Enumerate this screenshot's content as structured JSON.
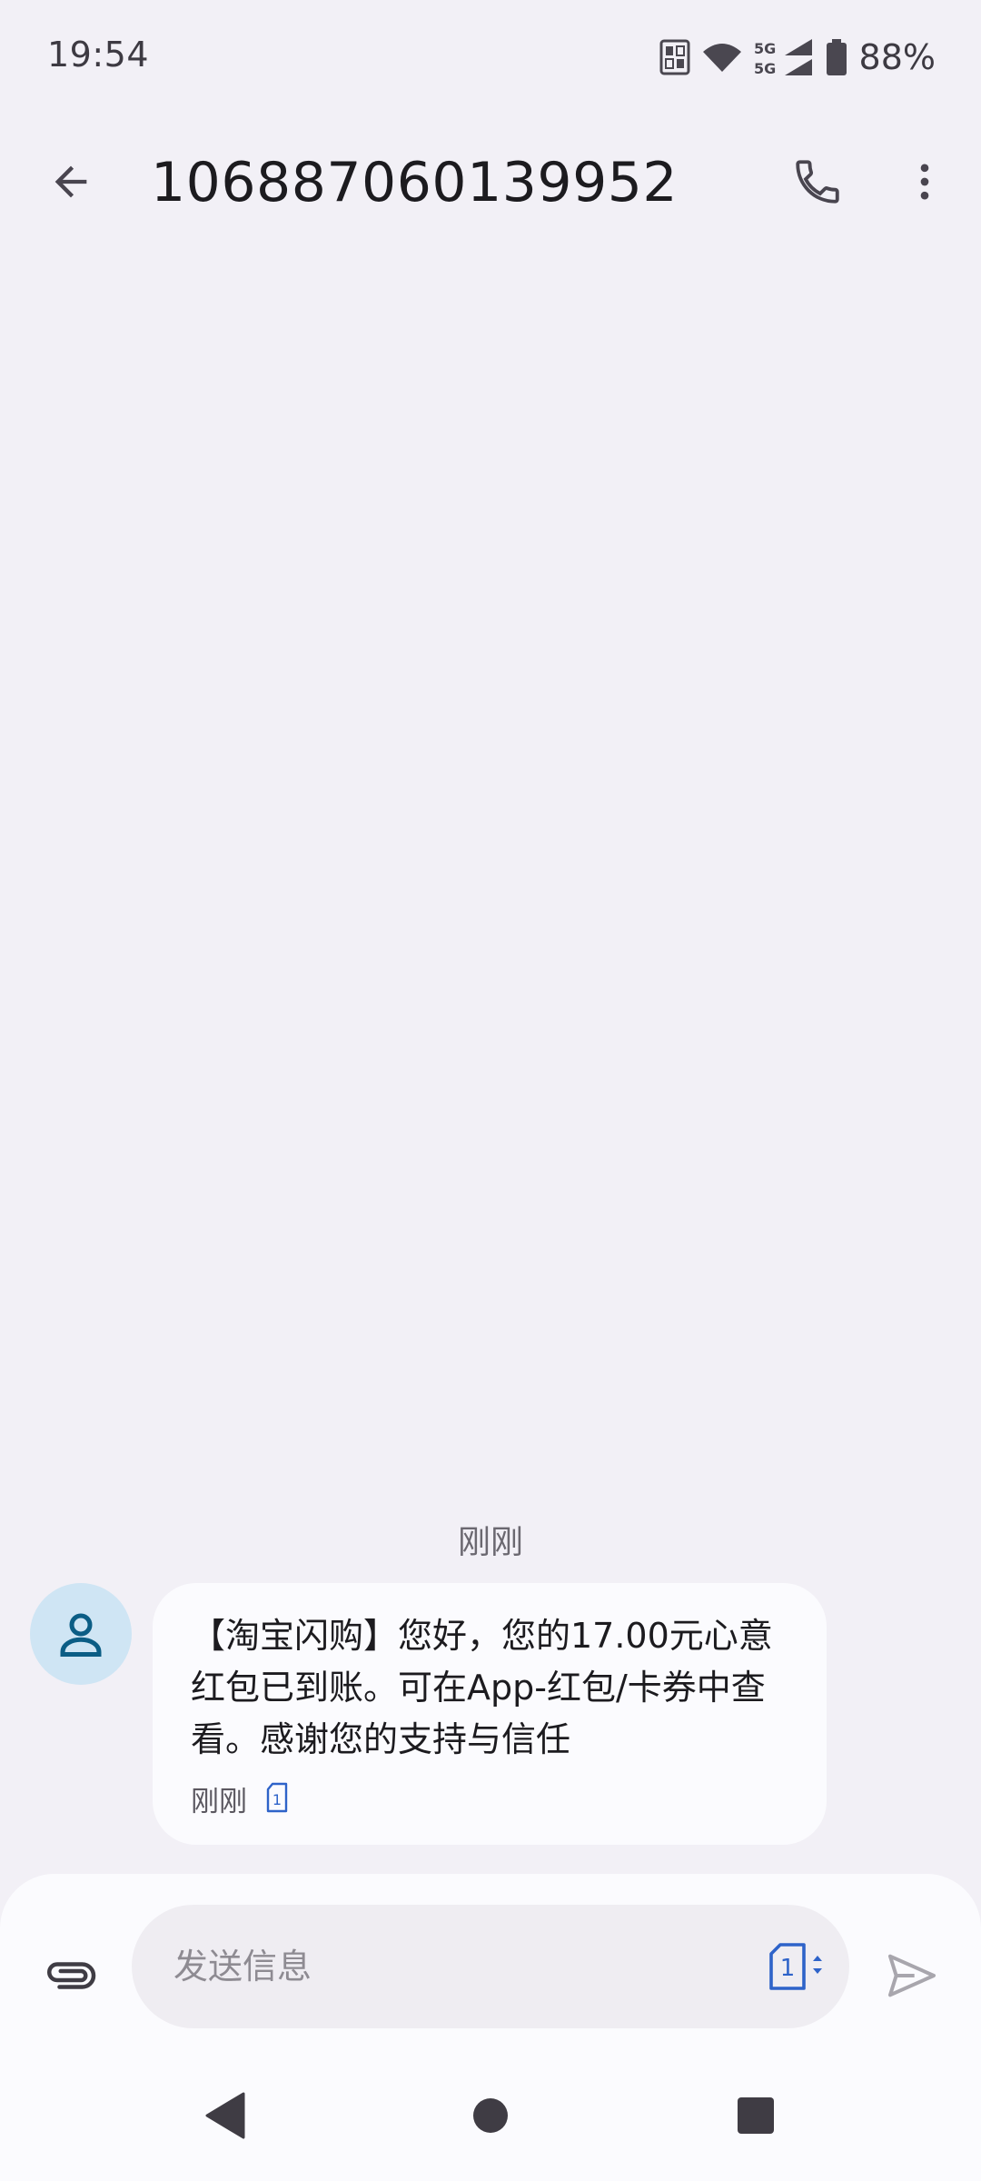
{
  "status_bar": {
    "time": "19:54",
    "network_label": "5G",
    "battery_text": "88%"
  },
  "app_bar": {
    "title": "106887060139952"
  },
  "conversation": {
    "day_label": "刚刚",
    "messages": [
      {
        "text": "【淘宝闪购】您好，您的17.00元心意红包已到账。可在App-红包/卡券中查看。感谢您的支持与信任",
        "time": "刚刚",
        "sim": "1"
      }
    ]
  },
  "compose": {
    "placeholder": "发送信息",
    "sim": "1"
  },
  "colors": {
    "background": "#f2f0f6",
    "bubble": "#fbfbfe",
    "avatar_bg": "#cfe5f4",
    "avatar_icon": "#0b5d85",
    "sim_blue": "#2e63c9",
    "icon_gray": "#49454f"
  },
  "icons": {
    "back": "arrow-left-icon",
    "call": "phone-icon",
    "more": "more-vert-icon",
    "avatar": "person-icon",
    "attach": "paperclip-icon",
    "send": "send-icon",
    "sim": "sim-card-icon"
  }
}
